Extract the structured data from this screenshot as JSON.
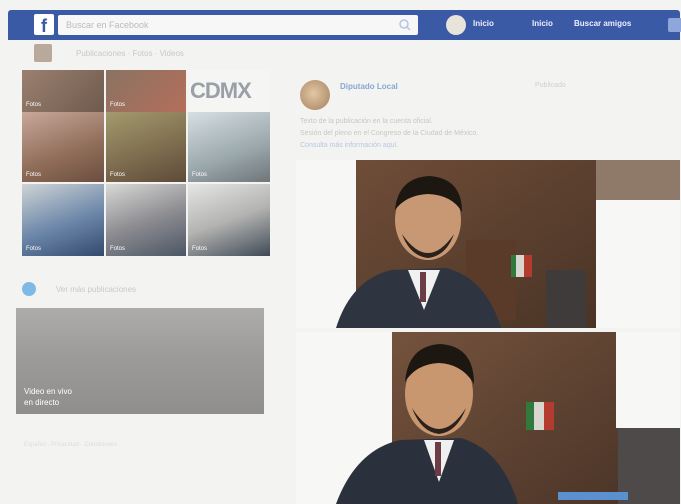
{
  "header": {
    "logo": "f",
    "search_placeholder": "Buscar en Facebook",
    "profile_name": "Inicio",
    "links": [
      "Inicio",
      "Buscar amigos"
    ]
  },
  "page": {
    "subhead": "Publicaciones · Fotos · Videos",
    "follow_text": "Ver más publicaciones"
  },
  "grid": {
    "tiles": [
      {
        "caption": "Fotos"
      },
      {
        "caption": "Fotos"
      },
      {
        "caption": "CDMX"
      },
      {
        "caption": "Fotos"
      },
      {
        "caption": "Fotos"
      },
      {
        "caption": "Fotos"
      },
      {
        "caption": "Fotos"
      },
      {
        "caption": "Fotos"
      },
      {
        "caption": "Fotos"
      }
    ],
    "cdmx_label": "CDMX"
  },
  "video": {
    "title_line1": "Video en vivo",
    "title_line2": "en directo"
  },
  "post": {
    "author": "Diputado Local",
    "meta": "Publicado",
    "body_line1": "Texto de la publicación en la cuenta oficial.",
    "body_line2": "Sesión del pleno en el Congreso de la Ciudad de México.",
    "body_line3": "Consulta más información aquí."
  },
  "footer": "Español · Privacidad · Condiciones"
}
